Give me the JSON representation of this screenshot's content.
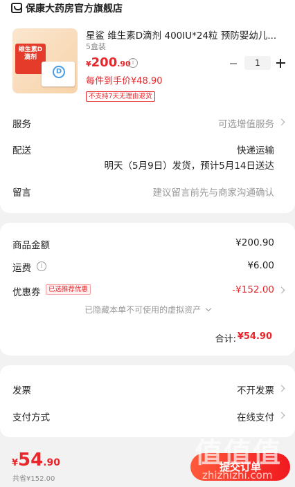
{
  "shop": {
    "name": "保康大药房官方旗舰店",
    "icon": "shop-icon"
  },
  "product": {
    "image_text": "维生素D滴剂",
    "image_letter": "D",
    "title": "星鲨 维生素D滴剂 400IU*24粒 预防婴幼儿...",
    "spec": "5盒装",
    "price_currency": "¥",
    "price_int": "200",
    "price_dec": ".90",
    "quantity": "1",
    "promo": "每件到手价¥48.90",
    "tag": "不支持7天无理由退货"
  },
  "service": {
    "label": "服务",
    "value": "可选增值服务"
  },
  "delivery": {
    "label": "配送",
    "value": "快递运输",
    "detail": "明天（5月9日）发货，预计5月14日送达"
  },
  "message": {
    "label": "留言",
    "placeholder": "建议留言前先与商家沟通确认"
  },
  "summary": {
    "goods_label": "商品金额",
    "goods_value": "¥200.90",
    "shipping_label": "运费",
    "shipping_value": "¥6.00",
    "coupon_label": "优惠券",
    "coupon_tag": "已选推荐优惠",
    "coupon_value": "-¥152.00",
    "hidden_assets": "已隐藏本单不可使用的虚拟资产",
    "total_label": "合计:",
    "total_value": "¥54.90"
  },
  "invoice": {
    "label": "发票",
    "value": "不开发票"
  },
  "payment": {
    "label": "支付方式",
    "value": "在线支付"
  },
  "footer": {
    "price_currency": "¥",
    "price_int": "54",
    "price_dec": ".90",
    "saved": "共省¥152.00",
    "submit": "提交订单"
  },
  "watermark": {
    "text": "值值值",
    "sub": "zhizhizhi.com"
  },
  "colors": {
    "accent": "#e8262b",
    "background": "#f2f2f2"
  }
}
